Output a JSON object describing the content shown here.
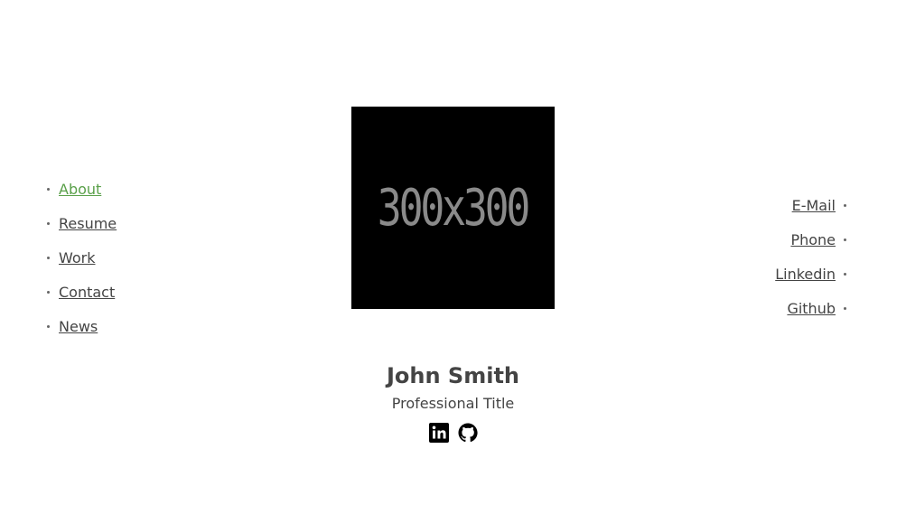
{
  "nav_left": [
    {
      "label": "About",
      "active": true
    },
    {
      "label": "Resume",
      "active": false
    },
    {
      "label": "Work",
      "active": false
    },
    {
      "label": "Contact",
      "active": false
    },
    {
      "label": "News",
      "active": false
    }
  ],
  "nav_right": [
    {
      "label": "E-Mail"
    },
    {
      "label": "Phone"
    },
    {
      "label": "Linkedin"
    },
    {
      "label": "Github"
    }
  ],
  "profile": {
    "image_placeholder_text": "300x300",
    "name": "John Smith",
    "title": "Professional Title"
  },
  "social_icons": [
    "linkedin-icon",
    "github-icon"
  ],
  "colors": {
    "active_link": "#5aa04a",
    "text": "#444444",
    "image_bg": "#000000"
  }
}
